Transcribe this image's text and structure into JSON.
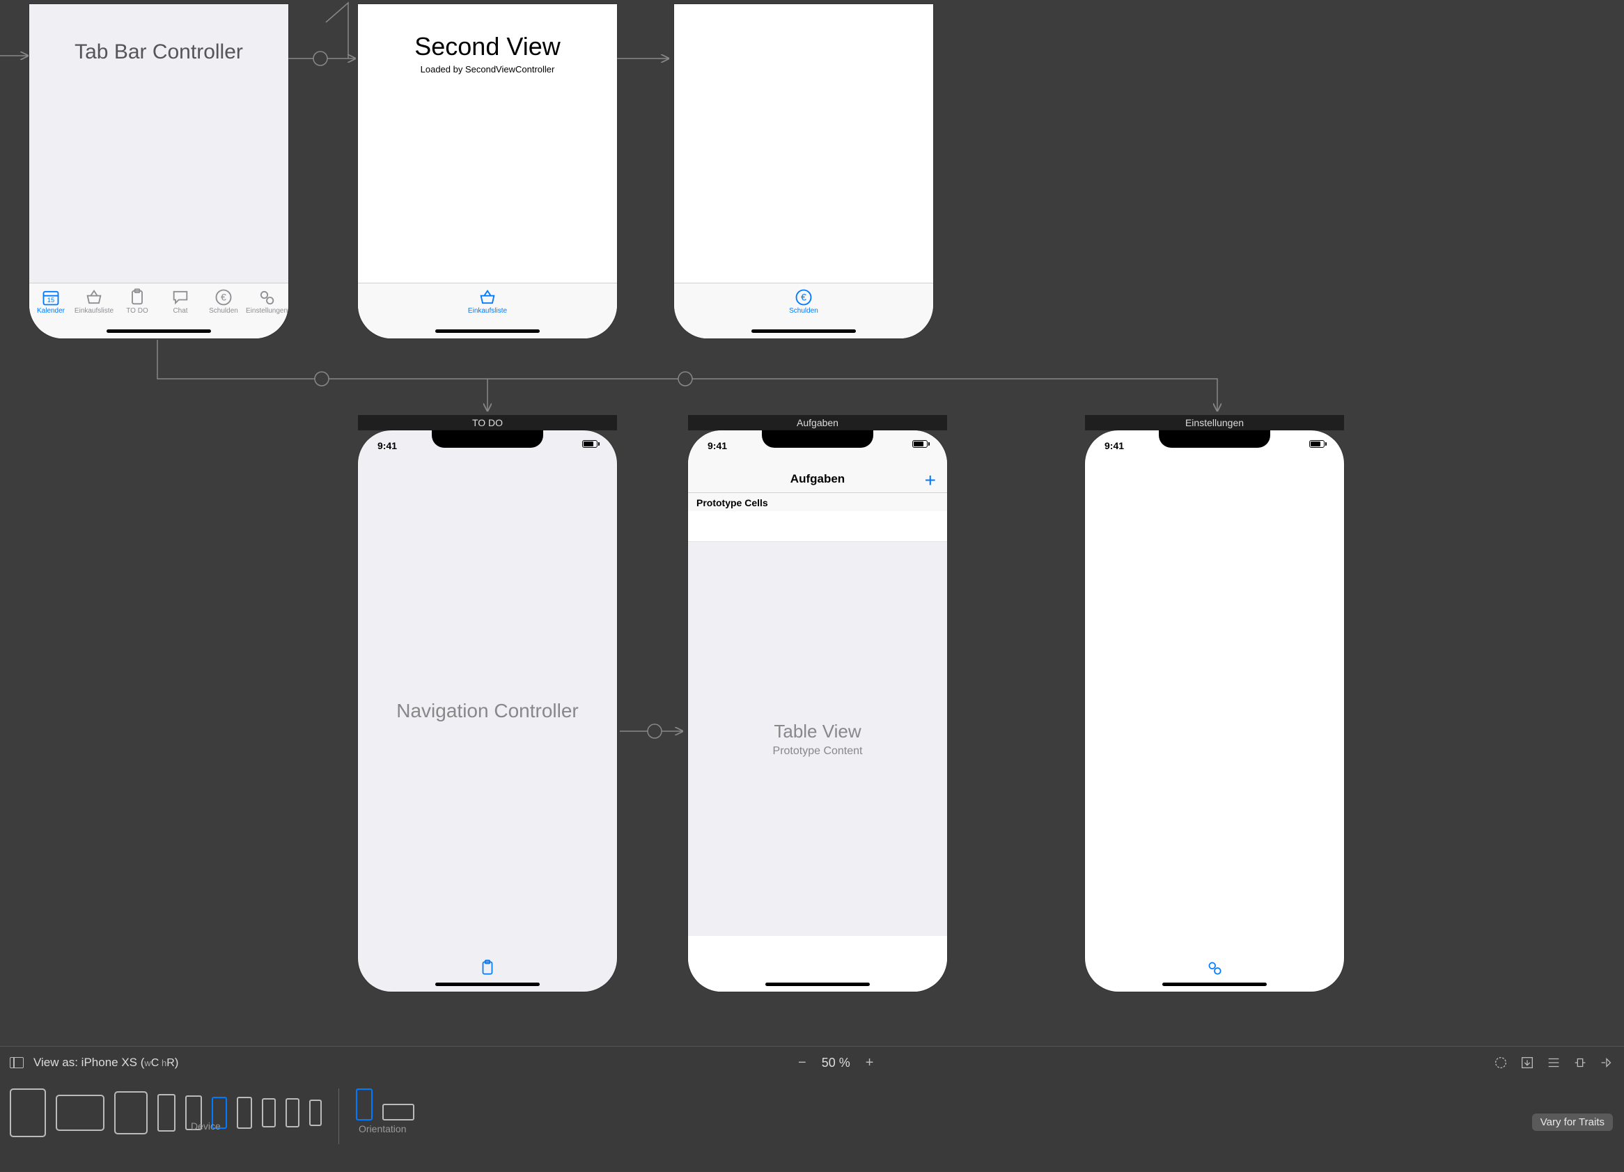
{
  "scenes": {
    "tabbar_controller": {
      "title": "Tab Bar Controller",
      "tabs": [
        "Kalender",
        "Einkaufsliste",
        "TO DO",
        "Chat",
        "Schulden",
        "Einstellungen"
      ]
    },
    "second_view": {
      "title": "Second View",
      "subtitle": "Loaded by SecondViewController",
      "tab_label": "Einkaufsliste"
    },
    "third_view": {
      "tab_label": "Schulden"
    },
    "todo_nav": {
      "scene_title": "TO DO",
      "status_time": "9:41",
      "center_title": "Navigation Controller"
    },
    "aufgaben": {
      "scene_title": "Aufgaben",
      "status_time": "9:41",
      "nav_title": "Aufgaben",
      "add_button": "+",
      "proto_header": "Prototype Cells",
      "table_title": "Table View",
      "table_subtitle": "Prototype Content"
    },
    "einstellungen": {
      "scene_title": "Einstellungen",
      "status_time": "9:41"
    }
  },
  "footer": {
    "view_as": "View as: iPhone XS",
    "size_class_w": "w",
    "size_class_c1": "C",
    "size_class_h": " h",
    "size_class_c2": "R",
    "zoom": "50 %",
    "device_label": "Device",
    "orientation_label": "Orientation",
    "vary_button": "Vary for Traits"
  }
}
